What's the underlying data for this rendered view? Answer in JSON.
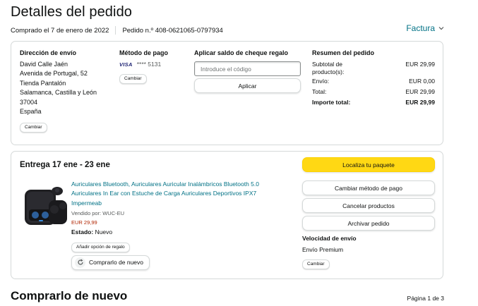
{
  "header": {
    "title": "Detalles del pedido",
    "ordered": "Comprado el 7 de enero de 2022",
    "order_number": "Pedido n.º 408-0621065-0797934",
    "invoice_label": "Factura"
  },
  "shipping": {
    "title": "Dirección de envío",
    "lines": [
      "David Calle Jaén",
      "Avenida de Portugal, 52",
      "Tienda Pantalón",
      "Salamanca, Castilla y León",
      "37004",
      "España"
    ],
    "change_label": "Cambiar"
  },
  "payment": {
    "title": "Método de pago",
    "card_brand": "VISA",
    "card_masked": "**** 5131",
    "change_label": "Cambiar"
  },
  "gift_cheque": {
    "title": "Aplicar saldo de cheque regalo",
    "placeholder": "Introduce el código",
    "apply_label": "Aplicar"
  },
  "summary": {
    "title": "Resumen del pedido",
    "rows": [
      {
        "label": "Subtotal de producto(s):",
        "value": "EUR 29,99"
      },
      {
        "label": "Envío:",
        "value": "EUR 0,00"
      },
      {
        "label": "Total:",
        "value": "EUR 29,99"
      },
      {
        "label": "Importe total:",
        "value": "EUR 29,99"
      }
    ]
  },
  "delivery": {
    "title": "Entrega 17 ene - 23 ene",
    "product_title": "Auriculares Bluetooth, Auriculares Auricular Inalámbricos Bluetooth 5.0 Auriculares In Ear con Estuche de Carga Auriculares Deportivos IPX7 Impermeab",
    "seller": "Vendido por: WUC-EU",
    "price": "EUR 29,99",
    "status_label": "Estado:",
    "status_value": "Nuevo",
    "gift_option_label": "Añadir opción de regalo",
    "rebuy_label": "Comprarlo de nuevo",
    "track_label": "Localiza tu paquete",
    "change_payment_label": "Cambiar método de pago",
    "cancel_label": "Cancelar productos",
    "archive_label": "Archivar pedido",
    "speed_title": "Velocidad de envío",
    "speed_value": "Envío Premium",
    "speed_change_label": "Cambiar"
  },
  "rebuy_section": {
    "title": "Comprarlo de nuevo",
    "pager": "Página 1 de 3"
  },
  "colors": {
    "link": "#007185",
    "primary_button": "#ffd814",
    "price": "#b12704",
    "border": "#d5d9d9"
  },
  "icons": {
    "invoice_chevron": "chevron-down-icon",
    "rebuy": "refresh-icon",
    "card": "visa-card-icon"
  }
}
